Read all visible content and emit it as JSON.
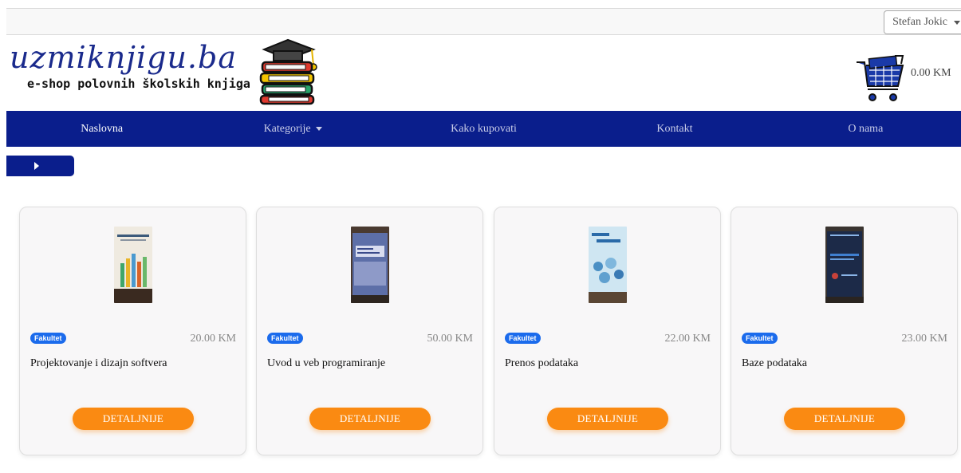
{
  "topbar": {
    "user_name": "Stefan Jokic"
  },
  "header": {
    "logo_title": "uzmiknjigu.ba",
    "logo_subtitle": "e-shop polovnih školskih knjiga",
    "cart_total": "0.00 KM"
  },
  "nav": {
    "items": [
      {
        "label": "Naslovna"
      },
      {
        "label": "Kategorije"
      },
      {
        "label": "Kako kupovati"
      },
      {
        "label": "Kontakt"
      },
      {
        "label": "O nama"
      }
    ]
  },
  "products": [
    {
      "category": "Fakultet",
      "price": "20.00 KM",
      "title": "Projektovanje i dizajn softvera",
      "button": "DETALJNIJE"
    },
    {
      "category": "Fakultet",
      "price": "50.00 KM",
      "title": "Uvod u veb programiranje",
      "button": "DETALJNIJE"
    },
    {
      "category": "Fakultet",
      "price": "22.00 KM",
      "title": "Prenos podataka",
      "button": "DETALJNIJE"
    },
    {
      "category": "Fakultet",
      "price": "23.00 KM",
      "title": "Baze podataka",
      "button": "DETALJNIJE"
    }
  ],
  "colors": {
    "nav_bg": "#0a1e8c",
    "button": "#fa8a12",
    "badge": "#1b6bec"
  }
}
